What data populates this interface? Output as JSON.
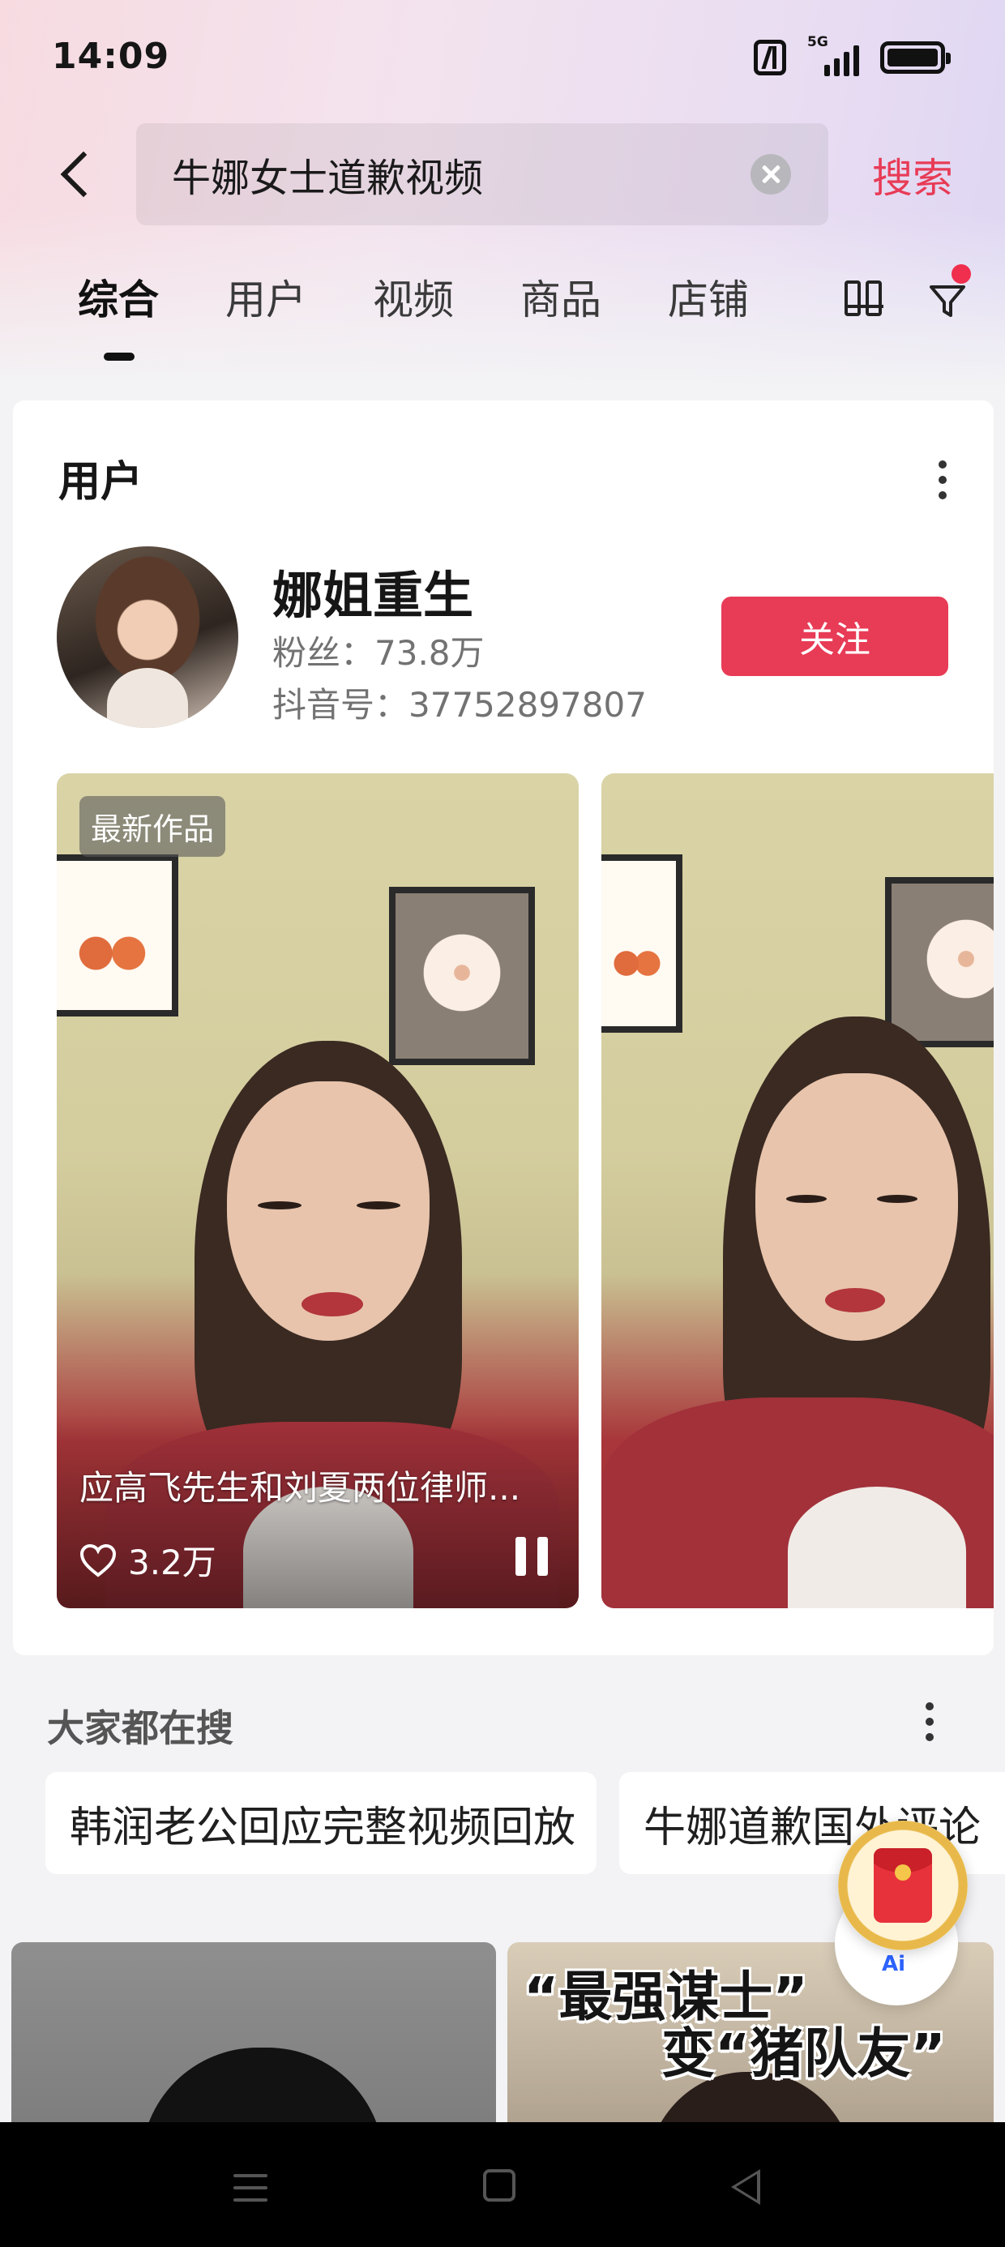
{
  "status_bar": {
    "time": "14:09",
    "network": "5G"
  },
  "search": {
    "query": "牛娜女士道歉视频",
    "button_label": "搜索"
  },
  "tabs": [
    {
      "label": "综合",
      "active": true
    },
    {
      "label": "用户",
      "active": false
    },
    {
      "label": "视频",
      "active": false
    },
    {
      "label": "商品",
      "active": false
    },
    {
      "label": "店铺",
      "active": false
    }
  ],
  "user_section": {
    "title": "用户",
    "user": {
      "name": "娜姐重生",
      "fans": "粉丝：73.8万",
      "douyin_id": "抖音号：37752897807",
      "follow_label": "关注"
    },
    "videos": [
      {
        "badge": "最新作品",
        "caption": "应高飞先生和刘夏两位律师...",
        "likes": "3.2万"
      }
    ]
  },
  "everyone_searching": {
    "title": "大家都在搜",
    "chips": [
      "韩润老公回应完整视频回放",
      "牛娜道歉国外评论"
    ]
  },
  "results": {
    "overlay_line_1": "“最强谋士”",
    "overlay_line_2": "变“猪队友”"
  },
  "floating": {
    "ai_label": "Ai"
  },
  "colors": {
    "accent": "#e83b56",
    "text": "#161616",
    "muted": "#727272",
    "background": "#f3f3f5"
  }
}
